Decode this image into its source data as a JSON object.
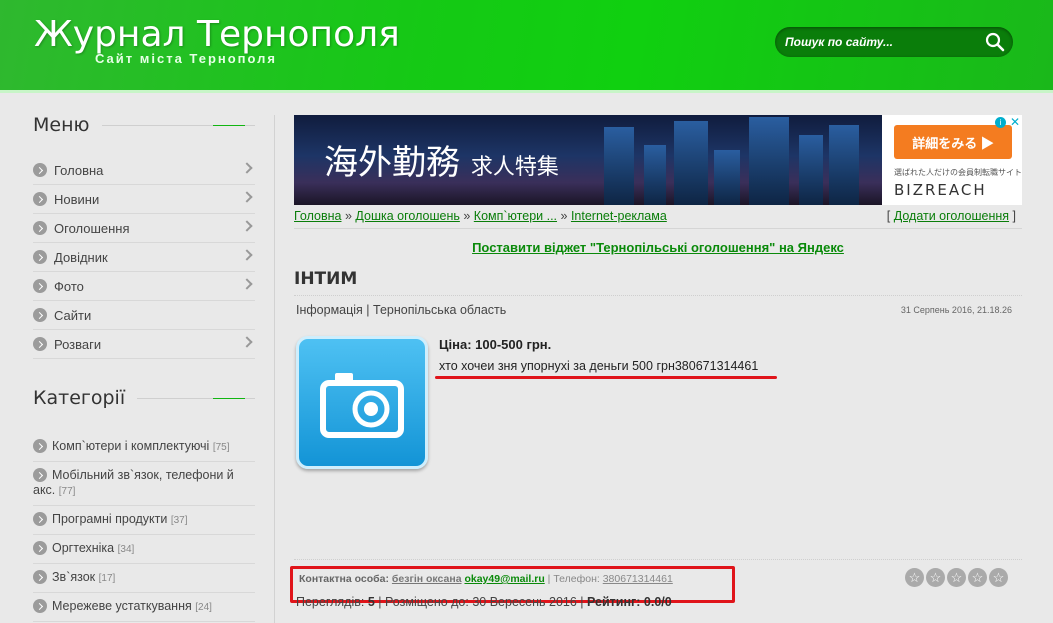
{
  "header": {
    "title": "Журнал Тернополя",
    "subtitle": "Сайт міста Тернополя",
    "search_placeholder": "Пошук по сайту..."
  },
  "sidebar": {
    "menu_title": "Меню",
    "menu": [
      {
        "label": "Головна"
      },
      {
        "label": "Новини"
      },
      {
        "label": "Оголошення"
      },
      {
        "label": "Довідник"
      },
      {
        "label": "Фото"
      },
      {
        "label": "Сайти"
      },
      {
        "label": "Розваги"
      }
    ],
    "categories_title": "Категорії",
    "categories": [
      {
        "label": "Комп`ютери і комплектуючі",
        "count": "[75]"
      },
      {
        "label": "Мобільний зв`язок, телефони й акс.",
        "count": "[77]"
      },
      {
        "label": "Програмні продукти",
        "count": "[37]"
      },
      {
        "label": "Оргтехніка",
        "count": "[34]"
      },
      {
        "label": "Зв`язок",
        "count": "[17]"
      },
      {
        "label": "Мережеве устаткування",
        "count": "[24]"
      }
    ]
  },
  "ad": {
    "headline": "海外勤務",
    "headline_small": "求人特集",
    "button": "詳細をみる ▶",
    "small_text": "選ばれた人だけの会員制転職サイト",
    "brand": "BIZREACH",
    "info": "i",
    "close": "✕"
  },
  "breadcrumbs": {
    "items": [
      "Головна",
      "Дошка оголошень",
      "Комп`ютери ...",
      "Internet-реклама"
    ],
    "separator": "»",
    "add_link": "Додати оголошення"
  },
  "widget_link": "Поставити віджет \"Тернопільські оголошення\" на Яндекс",
  "listing": {
    "title": "ІНТИМ",
    "info": "Інформація | Тернопільська область",
    "date": "31 Серпень 2016, 21.18.26",
    "price": "Ціна: 100-500 грн.",
    "description": "хто хочеи зня упорнухі за деньги 500 грн380671314461",
    "contact_label": "Контактна особа:",
    "contact_name": "безгін оксана",
    "contact_email": "okay49@mail.ru",
    "phone_label": "| Телефон:",
    "phone": "380671314461",
    "views_label": "Переглядів:",
    "views": "5",
    "placed_until": "| Розміщено до: 30 Вересень 2016 |",
    "rating_label": "Рейтинг:",
    "rating": "0.0/0",
    "stars": [
      "☆",
      "☆",
      "☆",
      "☆",
      "☆"
    ]
  },
  "colors": {
    "accent": "#0a8a0a",
    "highlight": "#e0141a"
  }
}
